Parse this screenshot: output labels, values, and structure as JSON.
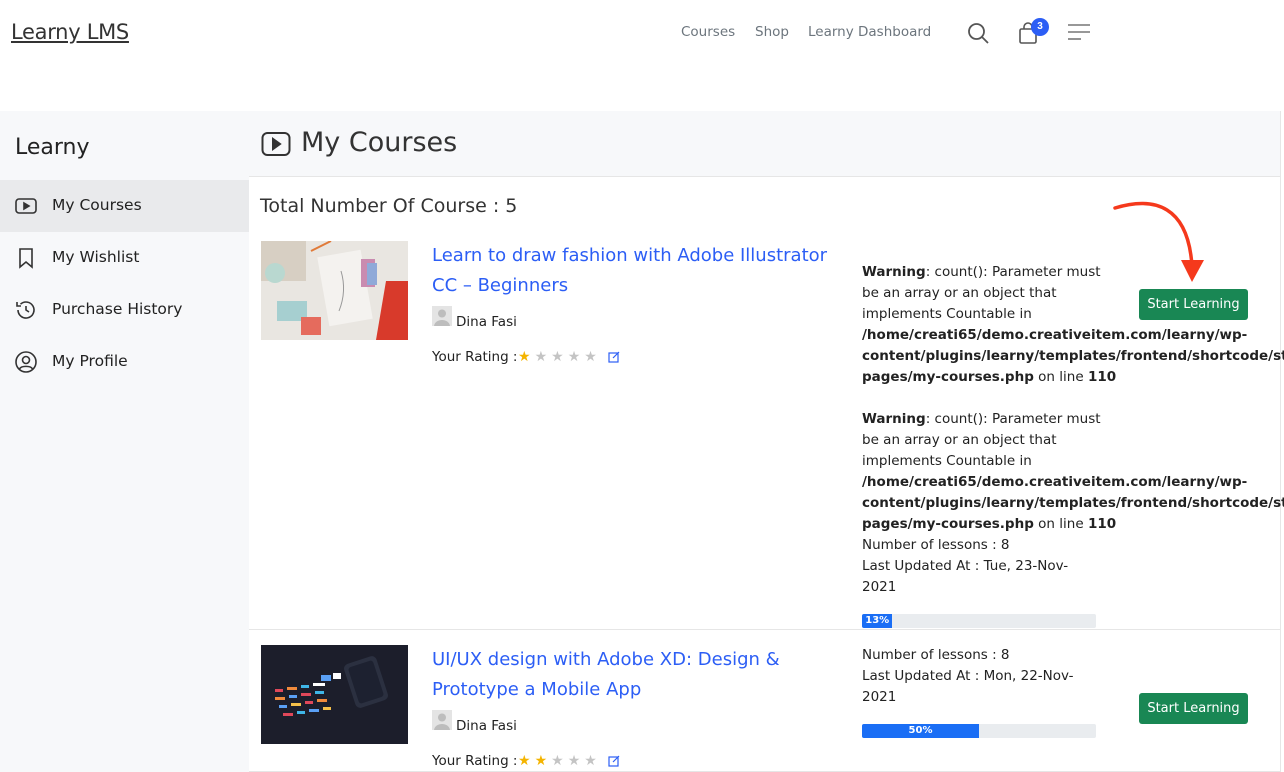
{
  "header": {
    "logo": "Learny LMS",
    "nav": [
      "Courses",
      "Shop",
      "Learny Dashboard"
    ],
    "cart_count": "3"
  },
  "sidebar": {
    "title": "Learny",
    "items": [
      {
        "label": "My Courses",
        "icon": "play-video-icon",
        "active": true
      },
      {
        "label": "My Wishlist",
        "icon": "bookmark-icon",
        "active": false
      },
      {
        "label": "Purchase History",
        "icon": "history-icon",
        "active": false
      },
      {
        "label": "My Profile",
        "icon": "user-circle-icon",
        "active": false
      }
    ]
  },
  "main": {
    "title": "My Courses",
    "total_label": "Total Number Of Course : 5"
  },
  "warning": {
    "prefix": "Warning",
    "line1": ": count(): Parameter must",
    "line2": "be an array or an object that",
    "line3": "implements Countable in",
    "path1": "/home/creati65/demo.creativeitem.com/learny/wp-",
    "path2": "content/plugins/learny/templates/frontend/shortcode/stud",
    "path3": "pages/my-courses.php",
    "on_line": " on line ",
    "line_no": "110"
  },
  "courses": [
    {
      "title_line1": "Learn to draw fashion with Adobe Illustrator",
      "title_line2": "CC – Beginners",
      "instructor": "Dina Fasi",
      "rating_label": "Your Rating :",
      "rating": 1,
      "lessons": "Number of lessons : 8",
      "updated_line1": "Last Updated At : Tue, 23-Nov-",
      "updated_line2": "2021",
      "progress": 13,
      "progress_label": "13%",
      "button": "Start Learning"
    },
    {
      "title_line1": "UI/UX design with Adobe XD: Design &",
      "title_line2": "Prototype a Mobile App",
      "instructor": "Dina Fasi",
      "rating_label": "Your Rating :",
      "rating": 2,
      "lessons": "Number of lessons : 8",
      "updated_line1": "Last Updated At : Mon, 22-Nov-",
      "updated_line2": "2021",
      "progress": 50,
      "progress_label": "50%",
      "button": "Start Learning"
    }
  ],
  "colors": {
    "link": "#2c5ef5",
    "button": "#198754",
    "progress": "#1a6ef5",
    "annotation_arrow": "#f5391c"
  }
}
